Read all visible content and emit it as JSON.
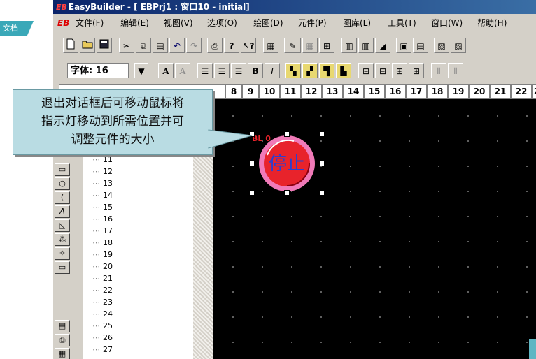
{
  "doc_badge": "文档",
  "window": {
    "title": "EasyBuilder - [  EBPrj1 : 窗口10  -  initial]",
    "logo": "EB"
  },
  "menu": [
    "文件(F)",
    "编辑(E)",
    "视图(V)",
    "选项(O)",
    "绘图(D)",
    "元件(P)",
    "图库(L)",
    "工具(T)",
    "窗口(W)",
    "帮助(H)"
  ],
  "menu_logo": "EB",
  "font_toolbar": {
    "font_label": "字体: 16",
    "bold_a": "A",
    "bold_b": "B",
    "italic_i": "I"
  },
  "ruler": [
    "8",
    "9",
    "10",
    "11",
    "12",
    "13",
    "14",
    "15",
    "16",
    "17",
    "18",
    "19",
    "20",
    "21",
    "22",
    "2"
  ],
  "tree_items": [
    "11",
    "12",
    "13",
    "14",
    "15",
    "16",
    "17",
    "18",
    "19",
    "20",
    "21",
    "22",
    "23",
    "24",
    "25",
    "26",
    "27"
  ],
  "callout": {
    "line1": "退出对话框后可移动鼠标将",
    "line2": "指示灯移动到所需位置并可",
    "line3": "调整元件的大小"
  },
  "indicator": {
    "label": "停止",
    "tag": "BL 0",
    "fill_color": "#e8232b",
    "ring_color": "#f07ab8",
    "text_color": "#2a3fd0"
  }
}
